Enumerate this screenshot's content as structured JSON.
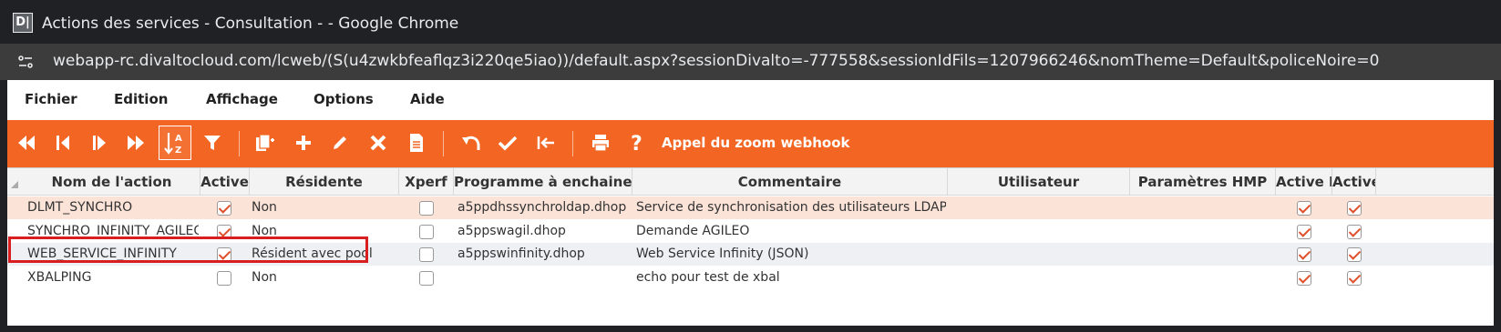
{
  "window": {
    "logo_text": "D|",
    "title": "Actions des services - Consultation - - Google Chrome"
  },
  "address_bar": {
    "url": "webapp-rc.divaltocloud.com/lcweb/(S(u4zwkbfeaflqz3i220qe5iao))/default.aspx?sessionDivalto=-777558&sessionIdFils=1207966246&nomTheme=Default&policeNoire=0"
  },
  "menu": {
    "items": [
      "Fichier",
      "Edition",
      "Affichage",
      "Options",
      "Aide"
    ]
  },
  "toolbar": {
    "accent_color": "#f26522",
    "buttons": [
      {
        "icon": "first-record-icon"
      },
      {
        "icon": "previous-record-icon"
      },
      {
        "icon": "next-record-icon"
      },
      {
        "icon": "last-record-icon"
      },
      {
        "icon": "sort-az-icon"
      },
      {
        "icon": "filter-icon"
      },
      {
        "icon": "duplicate-icon"
      },
      {
        "icon": "add-icon"
      },
      {
        "icon": "edit-icon"
      },
      {
        "icon": "delete-icon"
      },
      {
        "icon": "document-icon"
      },
      {
        "icon": "undo-icon"
      },
      {
        "icon": "validate-icon"
      },
      {
        "icon": "back-to-start-icon"
      },
      {
        "icon": "print-icon"
      },
      {
        "icon": "help-icon"
      }
    ],
    "webhook_label": "Appel du zoom webhook"
  },
  "grid": {
    "columns": [
      "Nom de l'action",
      "Active",
      "Résidente",
      "Xperf",
      "Programme à enchainer",
      "Commentaire",
      "Utilisateur",
      "Paramètres HMP",
      "Active R",
      "Active"
    ],
    "rows": [
      {
        "name": "DLMT_SYNCHRO",
        "active": true,
        "residente": "Non",
        "xperf": false,
        "programme": "a5ppdhssynchroldap.dhop",
        "commentaire": "Service de synchronisation des utilisateurs LDAP avec l'",
        "utilisateur": "",
        "parametres": "",
        "active_r": true,
        "active2": true
      },
      {
        "name": "SYNCHRO_INFINITY_AGILEO",
        "active": true,
        "residente": "Non",
        "xperf": false,
        "programme": "a5ppswagil.dhop",
        "commentaire": "Demande AGILEO",
        "utilisateur": "",
        "parametres": "",
        "active_r": true,
        "active2": true
      },
      {
        "name": "WEB_SERVICE_INFINITY",
        "active": true,
        "residente": "Résident avec pool",
        "xperf": false,
        "programme": "a5ppswinfinity.dhop",
        "commentaire": "Web Service Infinity (JSON)",
        "utilisateur": "",
        "parametres": "",
        "active_r": true,
        "active2": true
      },
      {
        "name": "XBALPING",
        "active": false,
        "residente": "Non",
        "xperf": false,
        "programme": "",
        "commentaire": "echo pour test de xbal",
        "utilisateur": "",
        "parametres": "",
        "active_r": true,
        "active2": true
      }
    ]
  }
}
